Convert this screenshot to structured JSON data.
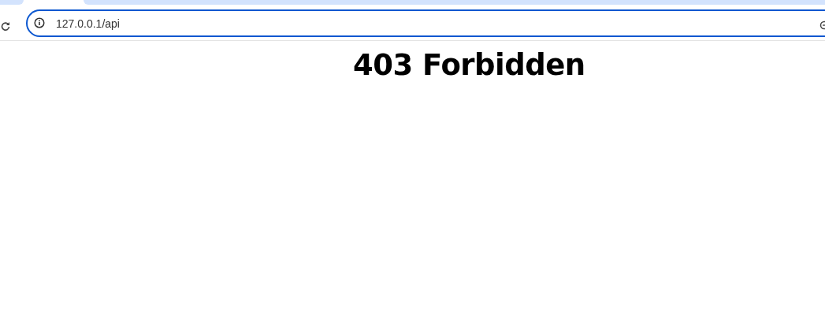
{
  "address_bar": {
    "value": "127.0.0.1/api"
  },
  "page": {
    "heading": "403 Forbidden"
  }
}
